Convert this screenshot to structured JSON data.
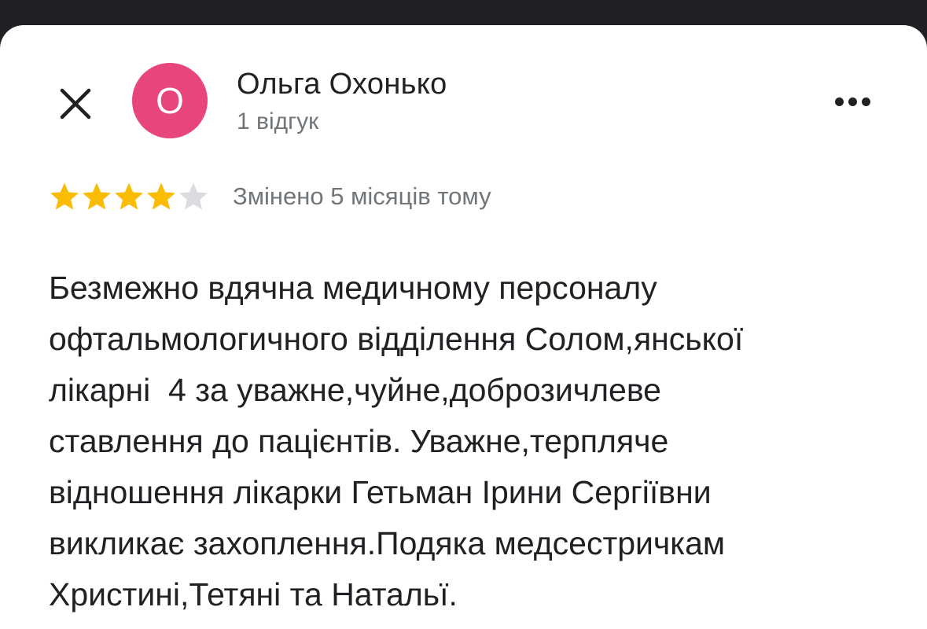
{
  "colors": {
    "avatar_bg": "#E8457A",
    "star_filled": "#FBBC04",
    "star_empty": "#DADCE0"
  },
  "header": {
    "close_icon": "close-icon",
    "more_icon": "more-horizontal-icon"
  },
  "author": {
    "initial": "О",
    "name": "Ольга Охонько",
    "review_count": "1 відгук"
  },
  "review": {
    "rating": 4,
    "rating_max": 5,
    "edited_label": "Змінено 5 місяців тому",
    "text_lines": [
      "Безмежно вдячна медичному персоналу",
      "офтальмологичного відділення Солом,янської",
      "лікарні  4 за уважне,чуйне,доброзичлеве",
      "ставлення до пацієнтів. Уважне,терпляче",
      "відношення лікарки Гетьман Ірини Сергіївни",
      "викликає захоплення.Подяка медсестричкам",
      "Христині,Тетяні та Натальї."
    ]
  }
}
